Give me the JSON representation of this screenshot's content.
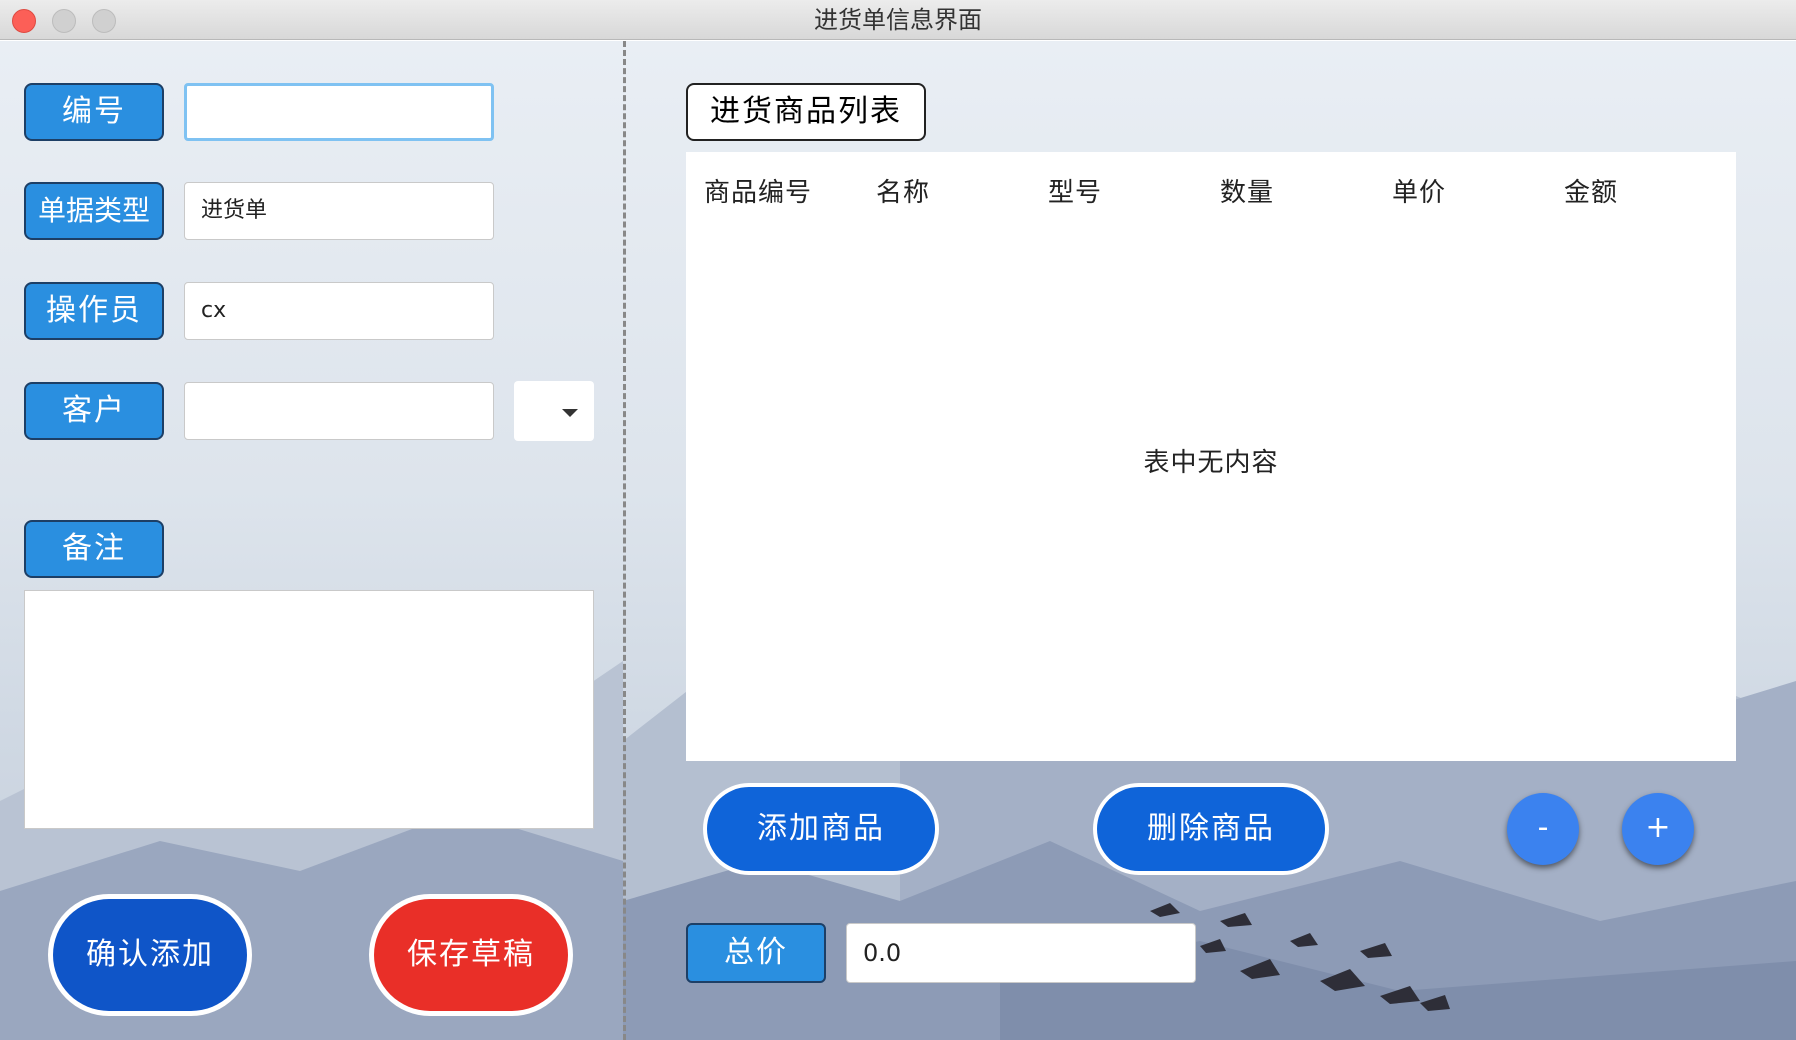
{
  "window": {
    "title": "进货单信息界面"
  },
  "form": {
    "id_label": "编号",
    "id_value": "",
    "type_label": "单据类型",
    "type_value": "进货单",
    "operator_label": "操作员",
    "operator_value": "cx",
    "customer_label": "客户",
    "customer_value": "",
    "notes_label": "备注",
    "notes_value": ""
  },
  "actions": {
    "confirm_label": "确认添加",
    "draft_label": "保存草稿"
  },
  "goods": {
    "title": "进货商品列表",
    "columns": [
      "商品编号",
      "名称",
      "型号",
      "数量",
      "单价",
      "金额"
    ],
    "rows": [],
    "empty_text": "表中无内容",
    "add_label": "添加商品",
    "delete_label": "删除商品",
    "minus_label": "-",
    "plus_label": "+"
  },
  "total": {
    "label": "总价",
    "value": "0.0"
  },
  "colors": {
    "label_blue": "#2a8fe0",
    "confirm_blue": "#0f55c8",
    "draft_red": "#e92f28",
    "pill_blue": "#0f64d9",
    "circle_blue": "#3b82ef"
  }
}
